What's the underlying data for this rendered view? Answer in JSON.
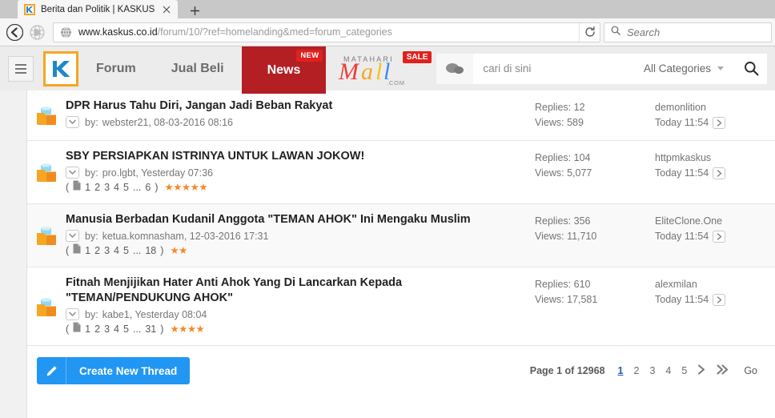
{
  "browser": {
    "tab": {
      "title": "Berita dan Politik | KASKUS",
      "favicon_icon": "kaskus-k-icon",
      "close_icon": "close-icon"
    },
    "new_tab_icon": "plus-icon",
    "back_icon": "back-arrow-icon",
    "forward_icon": "forward-arrow-icon",
    "url_domain": "www.kaskus.co.id",
    "url_path": "/forum/10/?ref=homelanding&med=forum_categories",
    "reload_icon": "reload-icon",
    "search": {
      "placeholder": "Search",
      "icon": "search-icon"
    },
    "globe_icon": "globe-icon"
  },
  "site_nav": {
    "menu_icon": "hamburger-menu-icon",
    "logo_icon": "kaskus-logo-icon",
    "links": [
      {
        "label": "Forum"
      },
      {
        "label": "Jual Beli"
      },
      {
        "label": "News",
        "badge": "NEW"
      }
    ],
    "matahari": {
      "top_text": "MATAHARI",
      "word": "Mall",
      "dotcom": ".COM",
      "badge": "SALE",
      "colors": [
        "#e8403a",
        "#e8403a",
        "#f5a623",
        "#f5c518",
        "#4285f4",
        "#34a853"
      ]
    },
    "chat_icon": "chat-bubbles-icon",
    "search": {
      "value": "cari di sini",
      "category_label": "All Categories",
      "caret_icon": "chevron-down-icon",
      "submit_icon": "search-icon"
    }
  },
  "threads": [
    {
      "icon": "open-folder-icon",
      "title": "DPR Harus Tahu Diri, Jangan Jadi Beban Rakyat",
      "chevron_icon": "chevron-down-icon",
      "by_label": "by:",
      "author": "webster21, 08-03-2016 08:16",
      "pages": null,
      "page_icon": null,
      "stars": 0,
      "replies": "Replies: 12",
      "views": "Views: 589",
      "last_user": "demonlition",
      "last_time": "Today 11:54",
      "jump_icon": "jump-to-last-post-icon",
      "alt": false
    },
    {
      "icon": "open-folder-icon",
      "title": "SBY PERSIAPKAN ISTRINYA UNTUK LAWAN JOKOW!",
      "chevron_icon": "chevron-down-icon",
      "by_label": "by:",
      "author": "pro.lgbt, Yesterday 07:36",
      "pages": [
        "1",
        "2",
        "3",
        "4",
        "5",
        "...",
        "6"
      ],
      "page_icon": "page-doc-icon",
      "stars": 5,
      "replies": "Replies: 104",
      "views": "Views: 5,077",
      "last_user": "httpmkaskus",
      "last_time": "Today 11:54",
      "jump_icon": "jump-to-last-post-icon",
      "alt": false
    },
    {
      "icon": "open-folder-icon",
      "title": "Manusia Berbadan Kudanil Anggota \"TEMAN AHOK\" Ini Mengaku Muslim",
      "chevron_icon": "chevron-down-icon",
      "by_label": "by:",
      "author": "ketua.komnasham, 12-03-2016 17:31",
      "pages": [
        "1",
        "2",
        "3",
        "4",
        "5",
        "...",
        "18"
      ],
      "page_icon": "page-doc-icon",
      "stars": 2,
      "replies": "Replies: 356",
      "views": "Views: 11,710",
      "last_user": "EliteClone.One",
      "last_time": "Today 11:54",
      "jump_icon": "jump-to-last-post-icon",
      "alt": true
    },
    {
      "icon": "open-folder-icon",
      "title": "Fitnah Menjijikan Hater Anti Ahok Yang Di Lancarkan Kepada \"TEMAN/PENDUKUNG AHOK\"",
      "chevron_icon": "chevron-down-icon",
      "by_label": "by:",
      "author": "kabe1, Yesterday 08:04",
      "pages": [
        "1",
        "2",
        "3",
        "4",
        "5",
        "...",
        "31"
      ],
      "page_icon": "page-doc-icon",
      "stars": 4,
      "replies": "Replies: 610",
      "views": "Views: 17,581",
      "last_user": "alexmilan",
      "last_time": "Today 11:54",
      "jump_icon": "jump-to-last-post-icon",
      "alt": false
    }
  ],
  "footer": {
    "create_button": {
      "label": "Create New Thread",
      "icon": "pencil-icon"
    },
    "pagination": {
      "info": "Page 1 of 12968",
      "current": "1",
      "pages": [
        "2",
        "3",
        "4",
        "5"
      ],
      "next_icon": "chevron-right-icon",
      "last_icon": "double-chevron-right-icon",
      "go_label": "Go"
    }
  },
  "colors": {
    "accent_blue": "#2196f3",
    "news_red": "#b41f23",
    "badge_red": "#e0211f",
    "logo_orange": "#f5a623",
    "star_orange": "#f5892b",
    "link_blue": "#1a5fb4"
  }
}
